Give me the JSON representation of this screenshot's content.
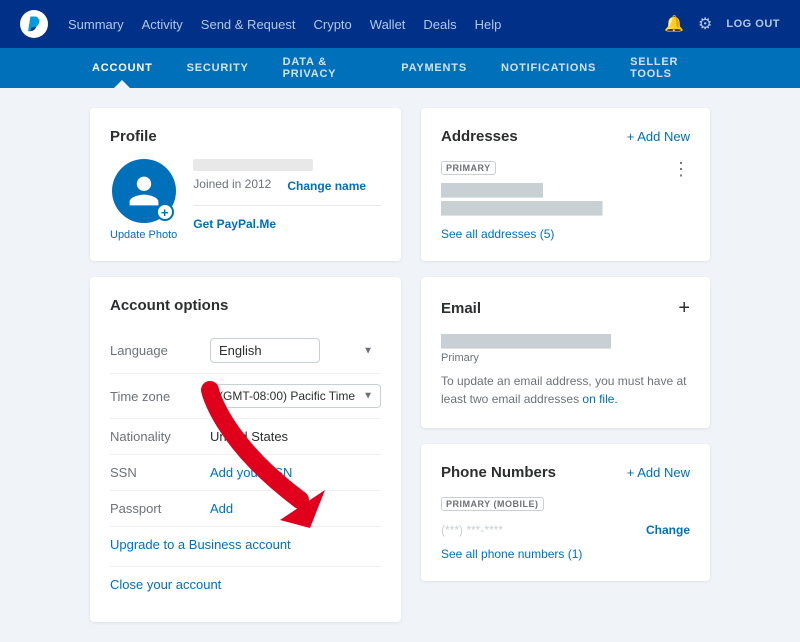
{
  "topNav": {
    "links": [
      "Summary",
      "Activity",
      "Send & Request",
      "Crypto",
      "Wallet",
      "Deals",
      "Help"
    ],
    "logout": "LOG OUT"
  },
  "secondaryNav": {
    "links": [
      "Account",
      "Security",
      "Data & Privacy",
      "Payments",
      "Notifications",
      "Seller Tools"
    ],
    "active": "Account"
  },
  "profile": {
    "title": "Profile",
    "joined": "Joined in 2012",
    "changeName": "Change name",
    "getPaypalMe": "Get PayPal.Me",
    "updatePhoto": "Update Photo"
  },
  "accountOptions": {
    "title": "Account options",
    "rows": [
      {
        "label": "Language",
        "type": "select",
        "value": "English"
      },
      {
        "label": "Time zone",
        "type": "select",
        "value": "(GMT-08:00) Pacific Time"
      },
      {
        "label": "Nationality",
        "type": "text",
        "value": "United States"
      },
      {
        "label": "SSN",
        "type": "link",
        "value": "Add your SSN"
      },
      {
        "label": "Passport",
        "type": "link",
        "value": "Add"
      }
    ],
    "upgradeBusiness": "Upgrade to a Business account",
    "closeAccount": "Close your account"
  },
  "addresses": {
    "title": "Addresses",
    "addNew": "+ Add New",
    "badge": "PRIMARY",
    "seeAll": "See all addresses (5)"
  },
  "email": {
    "title": "Email",
    "primary": "Primary",
    "note": "To update an email address, you must have at least two email addresses on file."
  },
  "phoneNumbers": {
    "title": "Phone Numbers",
    "addNew": "+ Add New",
    "badge": "PRIMARY (MOBILE)",
    "change": "Change",
    "seeAll": "See all phone numbers (1)"
  }
}
